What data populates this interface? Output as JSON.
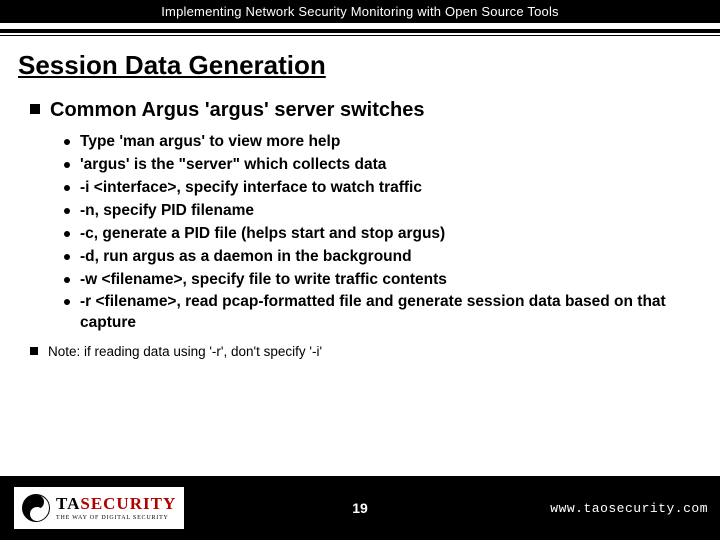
{
  "header": {
    "title": "Implementing Network Security Monitoring with Open Source Tools"
  },
  "slide": {
    "title": "Session Data Generation",
    "heading": "Common Argus 'argus' server switches",
    "bullets": [
      "Type 'man argus' to view more help",
      " 'argus' is the \"server\" which collects data",
      "-i <interface>, specify interface to watch traffic",
      "-n, specify PID filename",
      "-c, generate a PID file (helps start and stop argus)",
      "-d, run argus as a daemon in the background",
      "-w <filename>, specify file to write traffic contents",
      "-r <filename>, read pcap-formatted file and generate session data based on that capture"
    ],
    "note": "Note: if reading data using '-r', don't specify '-i'"
  },
  "footer": {
    "logo_main_a": "TA",
    "logo_main_b": "SECURITY",
    "logo_tag": "THE WAY OF DIGITAL SECURITY",
    "page": "19",
    "url": "www.taosecurity.com"
  }
}
